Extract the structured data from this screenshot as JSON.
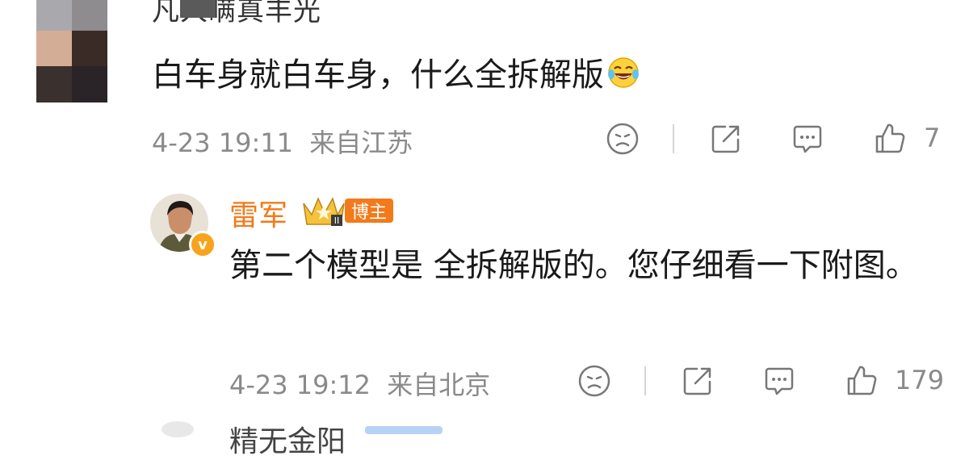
{
  "top_comment": {
    "username": "凡人瞒真丰光",
    "text": "白车身就白车身，什么全拆解版",
    "emoji": "laugh-cry-emoji",
    "date": "4-23 19:11",
    "location": "来自江苏",
    "like_count": "7"
  },
  "reply": {
    "username": "雷军",
    "badge_label": "博主",
    "text": "第二个模型是 全拆解版的。您仔细看一下附图。",
    "date": "4-23 19:12",
    "location": "来自北京",
    "like_count": "179"
  },
  "next_comment": {
    "username_partial": "精无金阳"
  },
  "colors": {
    "accent_orange": "#f27a1a",
    "meta_gray": "#8a8a8a",
    "vip_badge": "#f7a31c"
  }
}
